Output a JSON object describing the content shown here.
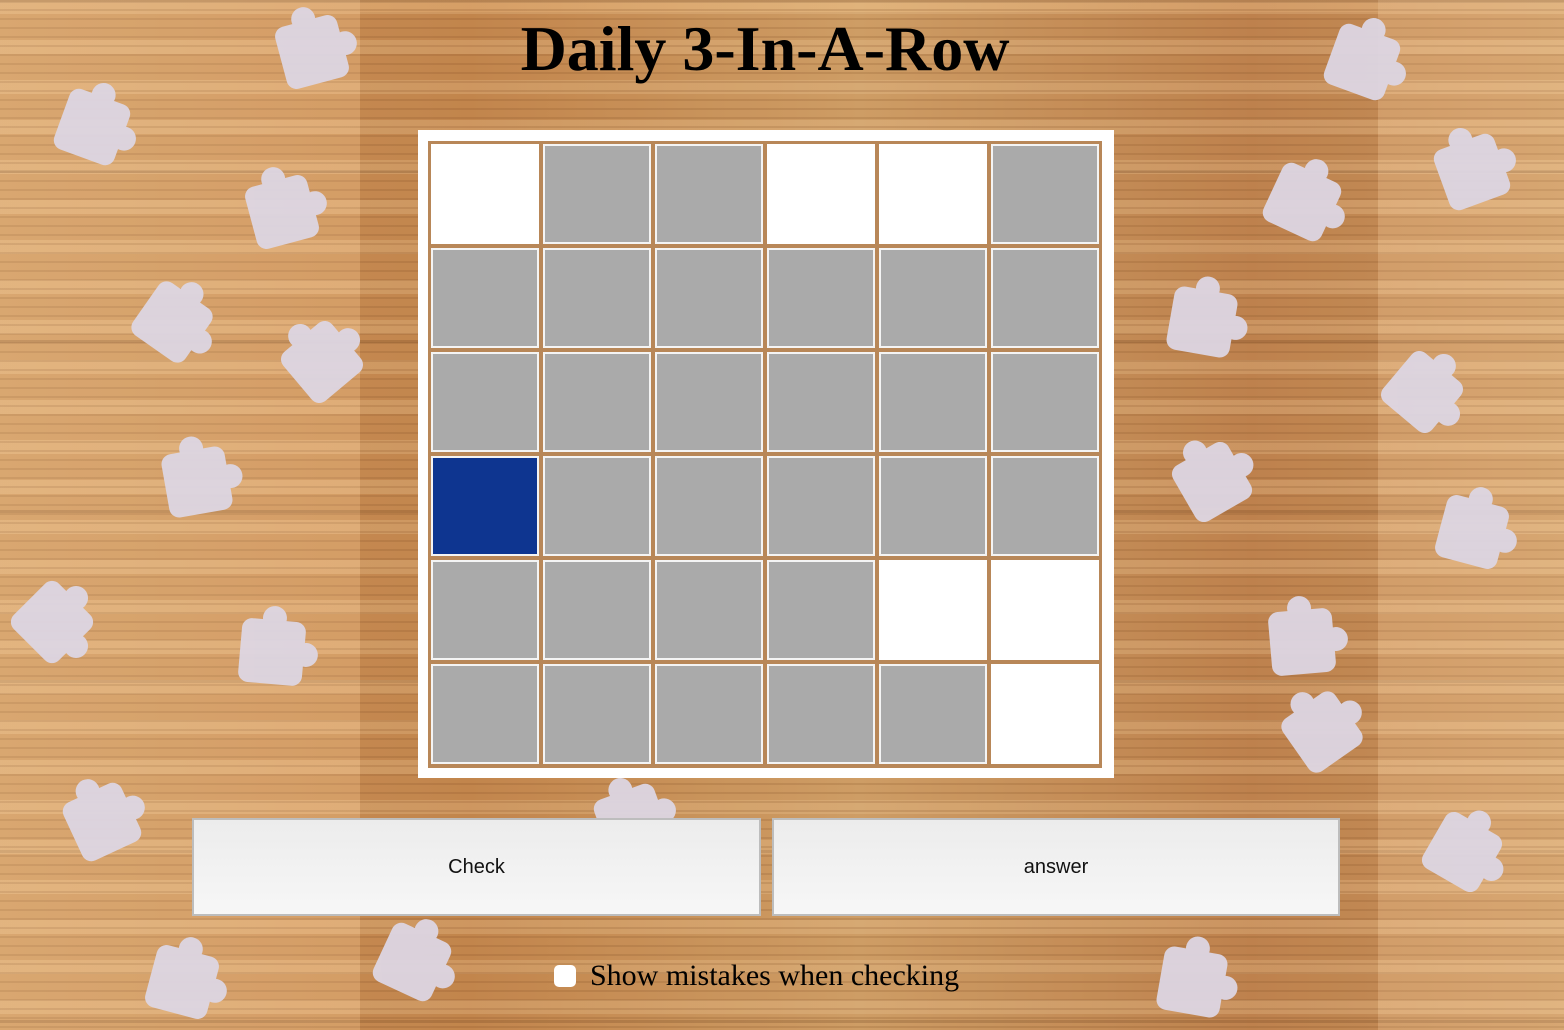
{
  "game": {
    "title": "Daily 3-In-A-Row",
    "rows": 6,
    "cols": 6,
    "grid": [
      [
        "white",
        "empty",
        "empty",
        "white",
        "white",
        "empty"
      ],
      [
        "empty",
        "empty",
        "empty",
        "empty",
        "empty",
        "empty"
      ],
      [
        "empty",
        "empty",
        "empty",
        "empty",
        "empty",
        "empty"
      ],
      [
        "blue",
        "empty",
        "empty",
        "empty",
        "empty",
        "empty"
      ],
      [
        "empty",
        "empty",
        "empty",
        "empty",
        "white",
        "white"
      ],
      [
        "empty",
        "empty",
        "empty",
        "empty",
        "empty",
        "white"
      ]
    ],
    "colors": {
      "blue": "#0e3590",
      "white": "#ffffff",
      "empty": "#aaaaaa"
    }
  },
  "controls": {
    "check_label": "Check",
    "answer_label": "answer",
    "show_mistakes_label": "Show mistakes when checking",
    "show_mistakes_checked": false
  }
}
